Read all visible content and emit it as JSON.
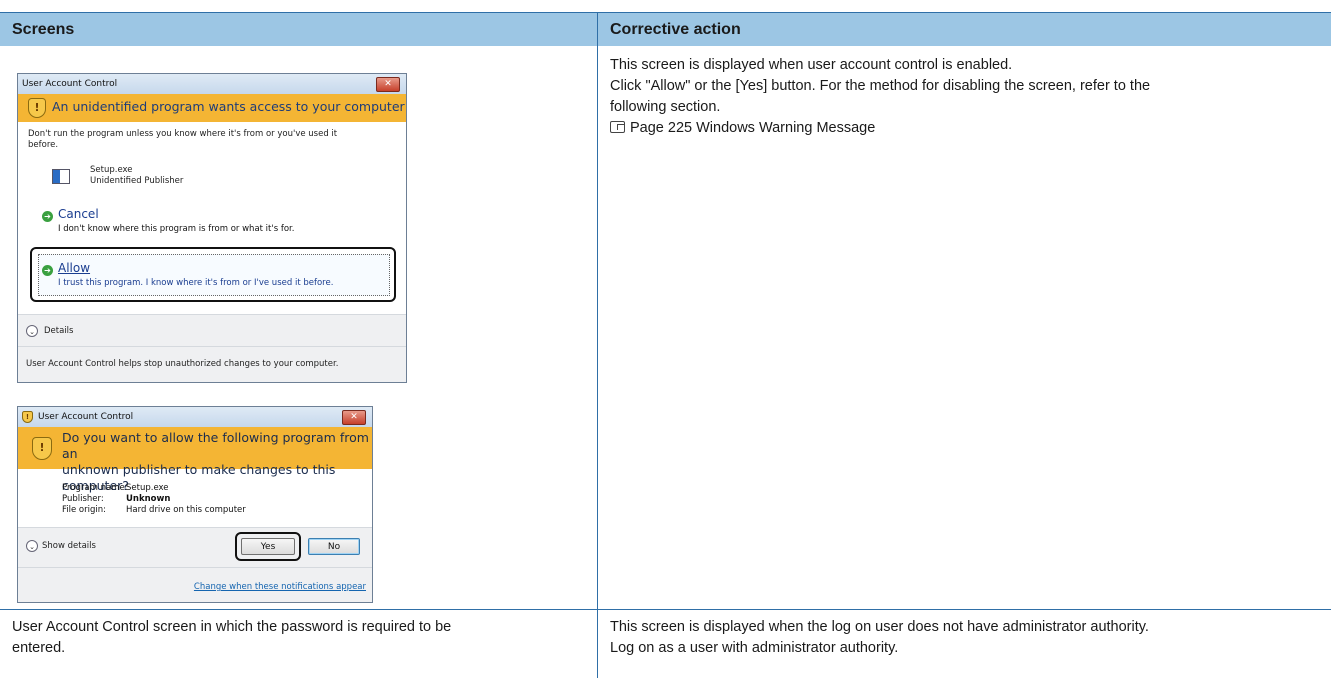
{
  "table": {
    "headers": [
      "Screens",
      "Corrective action"
    ],
    "rows": [
      {
        "action_lines": [
          "This screen is displayed when user account control is enabled.",
          "Click \"Allow\" or the [Yes] button. For the method for disabling the screen, refer to the",
          "following section."
        ],
        "reference": "Page 225 Windows Warning Message"
      },
      {
        "screen_lines": [
          "User Account Control screen in which the password is required to be",
          "entered."
        ],
        "action_lines": [
          "This screen is displayed when the log on user does not have administrator authority.",
          "Log on as a user with administrator authority."
        ]
      }
    ]
  },
  "dialog1": {
    "title": "User Account Control",
    "close": "✕",
    "banner": "An unidentified program wants access to your computer",
    "warning": [
      "Don't run the program unless you know where it's from or you've used it",
      "before."
    ],
    "program": "Setup.exe",
    "publisher": "Unidentified Publisher",
    "cancel_title": "Cancel",
    "cancel_sub": "I don't know where this program is from or what it's for.",
    "allow_title": "Allow",
    "allow_sub": "I trust this program. I know where it's from or I've used it before.",
    "details": "Details",
    "footer": "User Account Control helps stop unauthorized changes to your computer."
  },
  "dialog2": {
    "title": "User Account Control",
    "close": "✕",
    "banner": [
      "Do you want to allow the following program from an",
      "unknown publisher to make changes to this computer?"
    ],
    "fields": [
      {
        "label": "Program name:",
        "value": "Setup.exe"
      },
      {
        "label": "Publisher:",
        "value": "Unknown"
      },
      {
        "label": "File origin:",
        "value": "Hard drive on this computer"
      }
    ],
    "show_details": "Show details",
    "yes": "Yes",
    "no": "No",
    "link": "Change when these notifications appear"
  },
  "colors": {
    "header_bg": "#9cc6e4",
    "rule": "#2f6fa7",
    "warning_band": "#f4b534"
  },
  "icons": [
    "reference-icon",
    "shield-warning-icon",
    "program-icon",
    "green-arrow-icon",
    "chevron-down-icon",
    "close-icon"
  ]
}
